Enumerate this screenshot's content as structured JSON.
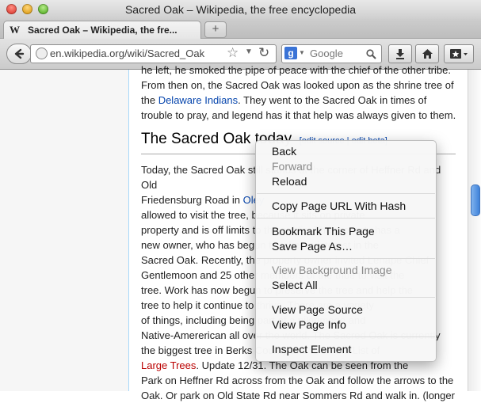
{
  "window": {
    "title": "Sacred Oak – Wikipedia, the free encyclopedia"
  },
  "tab": {
    "label": "Sacred Oak – Wikipedia, the fre...",
    "favicon": "W",
    "close": "×"
  },
  "newtab": "+",
  "nav": {
    "url": "en.wikipedia.org/wiki/Sacred_Oak",
    "search_engine": "g",
    "search_placeholder": "Google"
  },
  "icons": {
    "back": "back-arrow-icon",
    "globe": "globe-icon",
    "star": "star-icon",
    "reload": "reload-icon",
    "search": "magnifier-icon",
    "download": "download-icon",
    "home": "home-icon",
    "bookmarks": "bookmarks-icon"
  },
  "article": {
    "para1_line0": "he left, he smoked the pipe of peace with the chief of the other tribe.",
    "para1_line1": "From then on, the Sacred Oak was looked upon as the shrine tree of",
    "para1_the": "the ",
    "para1_link": "Delaware Indians",
    "para1_line2_rest": ". They went to the Sacred Oak in times of",
    "para1_line3": "trouble to pray, and legend has it that help was always given to them.",
    "heading": "The Sacred Oak today",
    "heading_edit": "[edit source | edit beta]",
    "p2": [
      "Today, the Sacred Oak still stands at the corner of Heffner Rd and Old",
      "Friedensburg Road in Oley Township. Few people are allowed",
      "allowed to visit the tree, because it sits on private",
      "property and is off limits to the public. The property has a",
      "new owner, who has begun to take an interest in the",
      "Sacred Oak. Recently, the property owner invited Lenape Chief",
      "Gentlemoon and 25 other members of the tribe to visit the",
      "tree. Work has now begun to preserve the tree and help the",
      "tree to help it continue to thrive. There are a variety",
      "of things, including being part of a pilgrimage and",
      "Native-Amererican all over the world. The Sacred Oak is currently",
      "the biggest tree in Berks County and is on the List of",
      "Large Trees. Update 12/31. The Oak can be seen from the",
      "Park on Heffner Rd across from the Oak and follow the arrows to the",
      "Oak. Or park on Old State Rd near Sommers Rd and walk in. (longer"
    ],
    "p2_link_oley": "Oley",
    "p2_link_large": "Large Trees"
  },
  "context_menu": {
    "back": "Back",
    "forward": "Forward",
    "reload": "Reload",
    "copy_url_hash": "Copy Page URL With Hash",
    "bookmark": "Bookmark This Page",
    "save_as": "Save Page As…",
    "view_bg": "View Background Image",
    "select_all": "Select All",
    "view_source": "View Page Source",
    "view_info": "View Page Info",
    "inspect": "Inspect Element"
  },
  "colors": {
    "link": "#0645ad",
    "redlink": "#ba0000",
    "scroll_thumb": "#3f82da"
  }
}
